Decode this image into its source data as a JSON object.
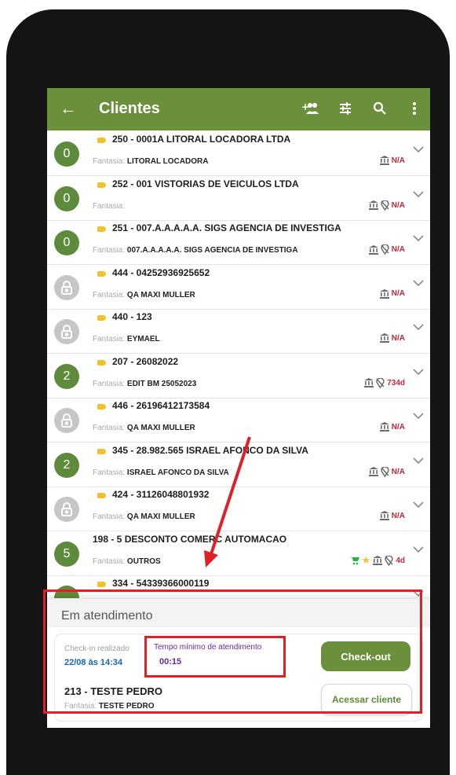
{
  "appbar": {
    "title": "Clientes",
    "icons": [
      "arrow-back-icon",
      "add-group-icon",
      "filter-sliders-icon",
      "search-icon",
      "more-vert-icon"
    ],
    "color": "#6b8f3a"
  },
  "clients": [
    {
      "badge": "0",
      "locked": false,
      "title": "250 - 0001A LITORAL LOCADORA LTDA",
      "fantasia_label": "Fantasia:",
      "fantasia": "LITORAL LOCADORA",
      "flags": [
        "bank-icon"
      ],
      "status": "N/A"
    },
    {
      "badge": "0",
      "locked": false,
      "title": "252 - 001 VISTORIAS DE VEICULOS LTDA",
      "fantasia_label": "Fantasia:",
      "fantasia": "",
      "flags": [
        "bank-icon",
        "location-off-icon"
      ],
      "status": "N/A"
    },
    {
      "badge": "0",
      "locked": false,
      "title": "251 - 007.A.A.A.A.A. SIGS AGENCIA DE INVESTIGA",
      "fantasia_label": "Fantasia:",
      "fantasia": "007.A.A.A.A.A. SIGS AGENCIA DE INVESTIGA",
      "flags": [
        "bank-icon",
        "location-off-icon"
      ],
      "status": "N/A"
    },
    {
      "badge": "",
      "locked": true,
      "title": "444 - 04252936925652",
      "fantasia_label": "Fantasia:",
      "fantasia": "QA MAXI MULLER",
      "flags": [
        "bank-icon"
      ],
      "status": "N/A"
    },
    {
      "badge": "",
      "locked": true,
      "title": "440 - 123",
      "fantasia_label": "Fantasia:",
      "fantasia": "EYMAEL",
      "flags": [
        "bank-icon"
      ],
      "status": "N/A"
    },
    {
      "badge": "2",
      "locked": false,
      "title": "207 - 26082022",
      "fantasia_label": "Fantasia:",
      "fantasia": "EDIT BM 25052023",
      "flags": [
        "bank-icon",
        "location-off-icon"
      ],
      "status": "734d"
    },
    {
      "badge": "",
      "locked": true,
      "title": "446 - 26196412173584",
      "fantasia_label": "Fantasia:",
      "fantasia": "QA MAXI MULLER",
      "flags": [
        "bank-icon"
      ],
      "status": "N/A"
    },
    {
      "badge": "2",
      "locked": false,
      "title": "345 - 28.982.565 ISRAEL AFONCO DA SILVA",
      "fantasia_label": "Fantasia:",
      "fantasia": "ISRAEL AFONCO DA SILVA",
      "flags": [
        "bank-icon",
        "location-off-icon"
      ],
      "status": "N/A"
    },
    {
      "badge": "",
      "locked": true,
      "title": "424 - 31126048801932",
      "fantasia_label": "Fantasia:",
      "fantasia": "QA MAXI MULLER",
      "flags": [
        "bank-icon"
      ],
      "status": "N/A"
    },
    {
      "badge": "5",
      "locked": false,
      "notag": true,
      "title": "198 - 5 DESCONTO COMERC AUTOMACAO",
      "fantasia_label": "Fantasia:",
      "fantasia": "OUTROS",
      "flags": [
        "cart-icon",
        "star-icon",
        "bank-icon",
        "location-off-icon"
      ],
      "status": "4d"
    },
    {
      "badge": "",
      "locked": false,
      "title": "334 - 54339366000119",
      "fantasia_label": "",
      "fantasia": "",
      "flags": [],
      "status": ""
    }
  ],
  "attendance": {
    "heading": "Em atendimento",
    "checkin_label": "Check-in realizado",
    "checkin_value": "22/08 às 14:34",
    "min_time_label": "Tempo mínimo de atendimento",
    "min_time_value": "00:15",
    "checkout_button": "Check-out",
    "client_title": "213 - TESTE PEDRO",
    "client_fantasia_label": "Fantasia:",
    "client_fantasia": "TESTE PEDRO",
    "access_button": "Acessar cliente"
  },
  "colors": {
    "accent_green": "#6b8f3a",
    "status_red": "#c2273a",
    "link_blue": "#1565c0",
    "highlight_red": "#e02027"
  }
}
